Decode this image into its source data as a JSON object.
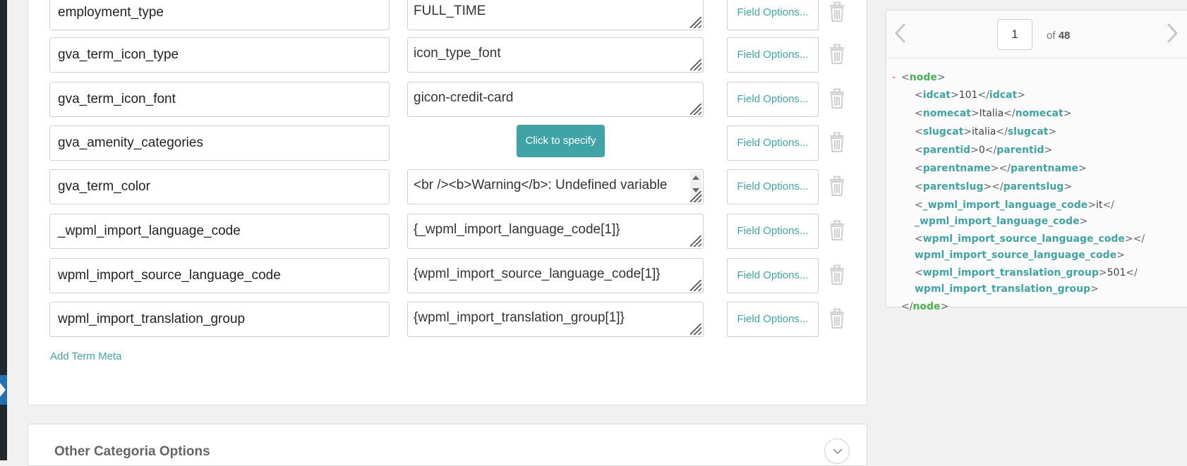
{
  "term_meta_rows": [
    {
      "name": "employment_type",
      "value": "FULL_TIME",
      "value_type": "textarea",
      "options_label": "Field Options..."
    },
    {
      "name": "gva_term_icon_type",
      "value": "icon_type_font",
      "value_type": "textarea",
      "options_label": "Field Options..."
    },
    {
      "name": "gva_term_icon_font",
      "value": "gicon-credit-card",
      "value_type": "textarea",
      "options_label": "Field Options..."
    },
    {
      "name": "gva_amenity_categories",
      "value": "Click to specify",
      "value_type": "button",
      "options_label": "Field Options..."
    },
    {
      "name": "gva_term_color",
      "value": "<br /><b>Warning</b>:  Undefined variable",
      "value_type": "scroll-textarea",
      "options_label": "Field Options..."
    },
    {
      "name": "_wpml_import_language_code",
      "value": "{_wpml_import_language_code[1]}",
      "value_type": "textarea",
      "options_label": "Field Options..."
    },
    {
      "name": "wpml_import_source_language_code",
      "value": "{wpml_import_source_language_code[1]}",
      "value_type": "textarea",
      "options_label": "Field Options..."
    },
    {
      "name": "wpml_import_translation_group",
      "value": "{wpml_import_translation_group[1]}",
      "value_type": "textarea",
      "options_label": "Field Options..."
    }
  ],
  "add_term_meta_label": "Add Term Meta",
  "other_options_title": "Other Categoria Options",
  "xml_preview": {
    "current_page": "1",
    "of_label": "of",
    "total_pages": "48",
    "collapse_marker": "-",
    "root_tag": "node",
    "elements": [
      {
        "tag": "idcat",
        "value": "101"
      },
      {
        "tag": "nomecat",
        "value": "Italia"
      },
      {
        "tag": "slugcat",
        "value": "italia"
      },
      {
        "tag": "parentid",
        "value": "0"
      },
      {
        "tag": "parentname",
        "value": ""
      },
      {
        "tag": "parentslug",
        "value": ""
      },
      {
        "tag": "_wpml_import_language_code",
        "value": "it"
      },
      {
        "tag": "wpml_import_source_language_code",
        "value": ""
      },
      {
        "tag": "wpml_import_translation_group",
        "value": "501"
      }
    ]
  },
  "colors": {
    "accent": "#40a4a6",
    "root_tag": "#46b450",
    "admin_bar": "#23282d",
    "admin_highlight": "#2271b1"
  }
}
